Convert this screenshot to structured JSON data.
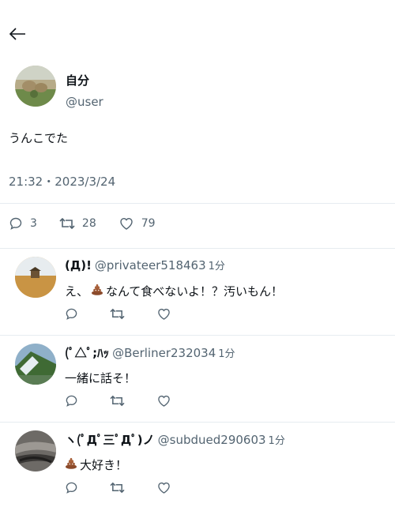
{
  "tweet": {
    "author_name": "自分",
    "author_handle": "@user",
    "text": "うんこでた",
    "timestamp": "21:32・2023/3/24",
    "stats": {
      "replies": "3",
      "retweets": "28",
      "likes": "79"
    }
  },
  "replies": [
    {
      "name": "(Д)!",
      "handle": "@privateer518463",
      "time": "1分",
      "text_before": "え、",
      "emoji": "poo-icon",
      "text_after": "なんて食べないよ！？汚いもん！"
    },
    {
      "name": "(ﾟ△ﾟ;ﾊｯ",
      "handle": "@Berliner232034",
      "time": "1分",
      "text": "一緒に話そ！"
    },
    {
      "name": "ヽ(ﾟДﾟ三ﾟДﾟ)ノ",
      "handle": "@subdued290603",
      "time": "1分",
      "emoji": "poo-icon",
      "text_after": "大好き！"
    }
  ],
  "colors": {
    "muted": "#536471",
    "divider": "#e6ecf0",
    "text": "#0f1419"
  }
}
